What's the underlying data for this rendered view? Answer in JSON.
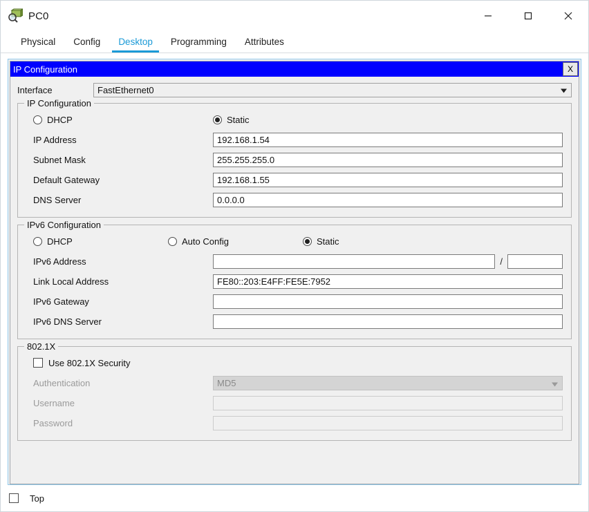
{
  "window": {
    "title": "PC0",
    "icon": "pc-device-icon",
    "controls": {
      "minimize": "minimize-icon",
      "maximize": "maximize-icon",
      "close": "close-icon"
    }
  },
  "tabs": [
    {
      "label": "Physical",
      "active": false
    },
    {
      "label": "Config",
      "active": false
    },
    {
      "label": "Desktop",
      "active": true
    },
    {
      "label": "Programming",
      "active": false
    },
    {
      "label": "Attributes",
      "active": false
    }
  ],
  "dialog": {
    "title": "IP Configuration",
    "close_label": "X",
    "titlebar_color": "#0000ff",
    "accent_color": "#1a9ad7"
  },
  "interface": {
    "label": "Interface",
    "value": "FastEthernet0",
    "options": [
      "FastEthernet0"
    ]
  },
  "ip_config": {
    "legend": "IP Configuration",
    "modes": [
      {
        "label": "DHCP",
        "selected": false
      },
      {
        "label": "Static",
        "selected": true
      }
    ],
    "fields": [
      {
        "label": "IP Address",
        "value": "192.168.1.54",
        "placeholder": ""
      },
      {
        "label": "Subnet Mask",
        "value": "255.255.255.0",
        "placeholder": ""
      },
      {
        "label": "Default Gateway",
        "value": "192.168.1.55",
        "placeholder": ""
      },
      {
        "label": "DNS Server",
        "value": "0.0.0.0",
        "placeholder": ""
      }
    ]
  },
  "ipv6_config": {
    "legend": "IPv6 Configuration",
    "modes": [
      {
        "label": "DHCP",
        "selected": false
      },
      {
        "label": "Auto Config",
        "selected": false
      },
      {
        "label": "Static",
        "selected": true
      }
    ],
    "address": {
      "label": "IPv6 Address",
      "value": "",
      "prefix": "",
      "separator": "/"
    },
    "fields": [
      {
        "label": "Link Local Address",
        "value": "FE80::203:E4FF:FE5E:7952"
      },
      {
        "label": "IPv6 Gateway",
        "value": ""
      },
      {
        "label": "IPv6 DNS Server",
        "value": ""
      }
    ]
  },
  "dot1x": {
    "legend": "802.1X",
    "use_security": {
      "label": "Use 802.1X Security",
      "checked": false
    },
    "authentication": {
      "label": "Authentication",
      "value": "MD5",
      "options": [
        "MD5"
      ],
      "disabled": true
    },
    "username": {
      "label": "Username",
      "value": "",
      "disabled": true
    },
    "password": {
      "label": "Password",
      "value": "",
      "disabled": true
    }
  },
  "footer": {
    "top_checkbox": {
      "label": "Top",
      "checked": false
    }
  }
}
